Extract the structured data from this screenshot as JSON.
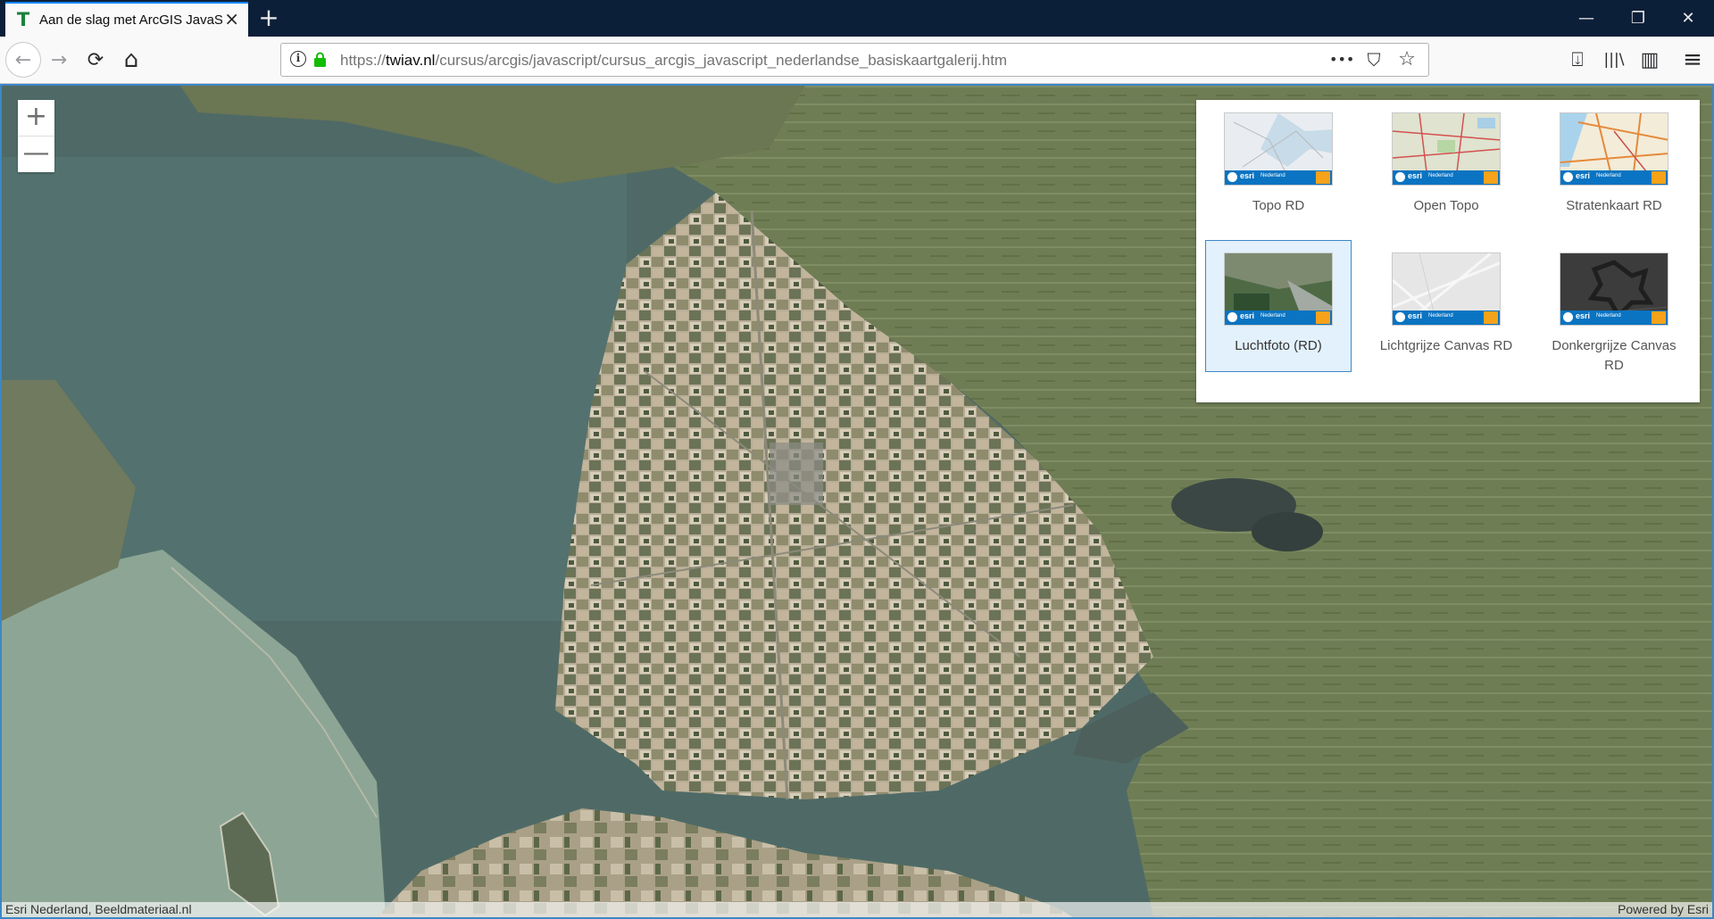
{
  "browser": {
    "tab": {
      "title": "Aan de slag met ArcGIS JavaScript",
      "favicon": "T",
      "close_icon": "×"
    },
    "new_tab_icon": "+",
    "window_controls": {
      "minimize": "—",
      "restore": "❐",
      "close": "✕"
    },
    "nav": {
      "back_icon": "←",
      "forward_icon": "→",
      "reload_icon": "⟳",
      "home_icon": "⌂"
    },
    "url": {
      "scheme": "https://",
      "host": "twiav.nl",
      "path": "/cursus/arcgis/javascript/cursus_arcgis_javascript_nederlandse_basiskaartgalerij.htm"
    },
    "url_actions": {
      "page_actions": "•••",
      "pocket": "⛉",
      "bookmark": "☆"
    },
    "toolbar": {
      "downloads": "⍗",
      "library": "|||\\",
      "sidebar": "▥",
      "menu": "≡"
    }
  },
  "map": {
    "zoom_in": "+",
    "zoom_out": "—",
    "attribution_left": "Esri Nederland, Beeldmateriaal.nl",
    "attribution_right": "Powered by Esri"
  },
  "gallery": {
    "selected": "Luchtfoto (RD)",
    "items": [
      {
        "label": "Topo RD",
        "style": "topo"
      },
      {
        "label": "Open Topo",
        "style": "opentopo"
      },
      {
        "label": "Stratenkaart RD",
        "style": "streets"
      },
      {
        "label": "Luchtfoto (RD)",
        "style": "imagery"
      },
      {
        "label": "Lichtgrijze Canvas RD",
        "style": "lightgray"
      },
      {
        "label": "Donkergrijze Canvas RD",
        "style": "darkgray"
      }
    ],
    "thumb_brand": "esri",
    "thumb_sub": "Nederland"
  },
  "colors": {
    "accent": "#3d87c7",
    "tabbar": "#0c1f38",
    "esri_blue": "#0a74c2"
  }
}
